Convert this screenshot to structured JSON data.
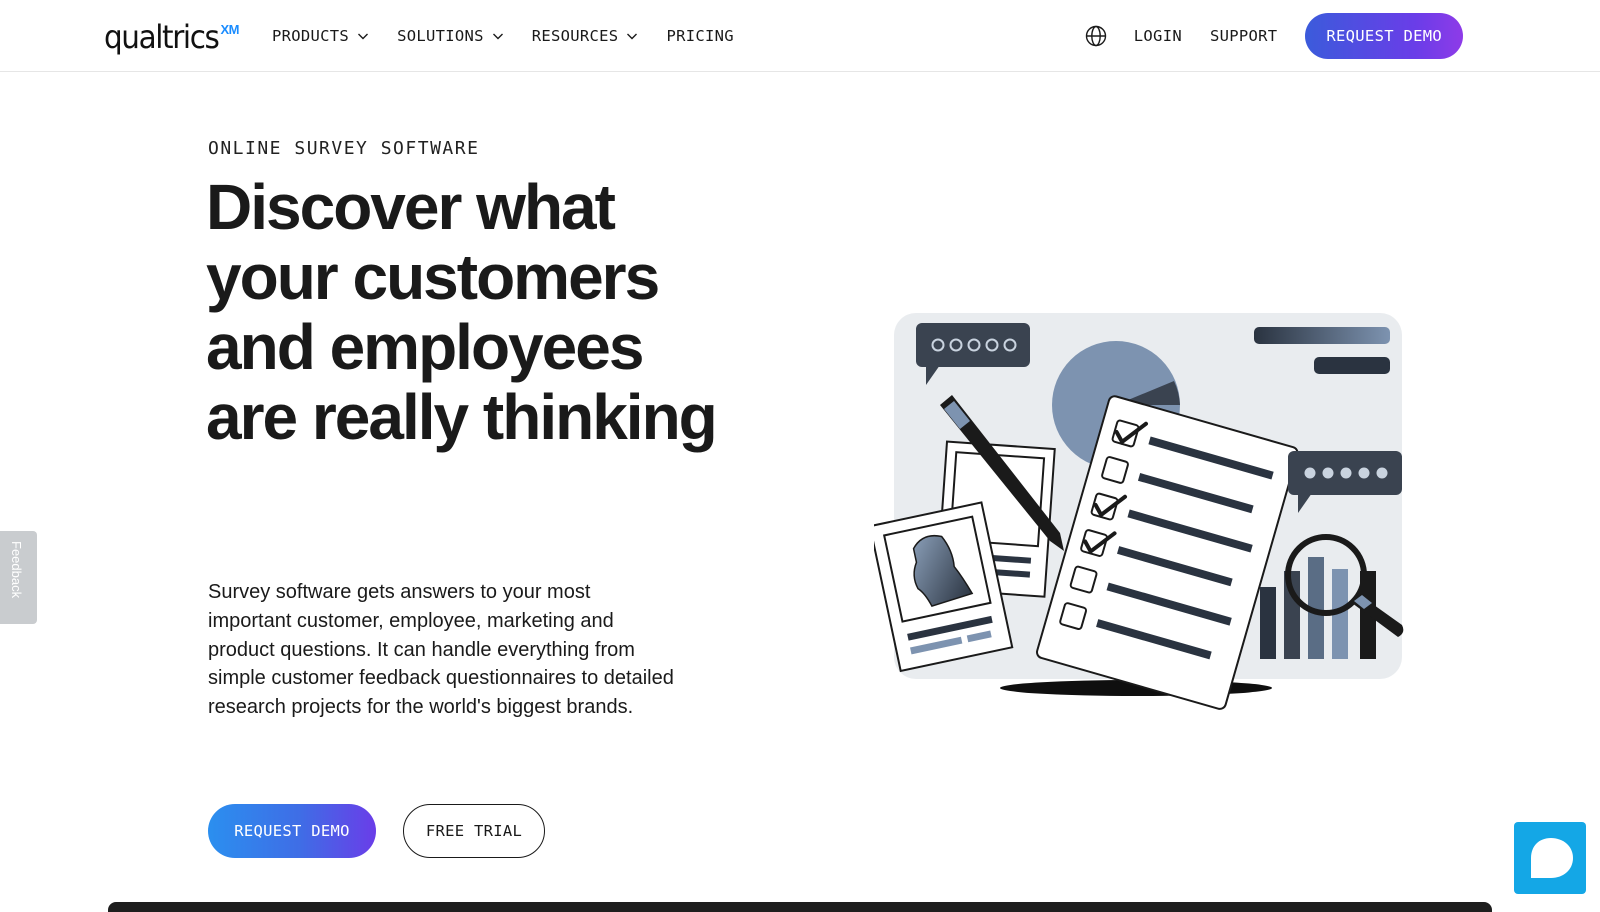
{
  "header": {
    "logo_word": "qualtrics",
    "logo_badge": "XM",
    "nav": [
      {
        "label": "PRODUCTS"
      },
      {
        "label": "SOLUTIONS"
      },
      {
        "label": "RESOURCES"
      },
      {
        "label": "PRICING"
      }
    ],
    "right_nav": {
      "login": "LOGIN",
      "support": "SUPPORT",
      "request_demo": "REQUEST DEMO"
    }
  },
  "hero": {
    "eyebrow": "ONLINE SURVEY SOFTWARE",
    "headline": "Discover what your customers and employees are really thinking",
    "body": "Survey software gets answers to your most important customer, employee, marketing and product questions. It can handle everything from simple customer feedback questionnaires to detailed research projects for the world's biggest brands.",
    "cta_primary": "REQUEST DEMO",
    "cta_secondary": "FREE TRIAL"
  },
  "feedback_tab": "Feedback",
  "icons": {
    "globe": "globe-icon",
    "chevron": "chevron-down-icon",
    "chat": "chat-bubble-icon"
  },
  "colors": {
    "brand_blue": "#1a8cff",
    "demo_gradient_start": "#3b5bdb",
    "demo_gradient_end": "#8e3be8",
    "chat_button": "#14a7e6",
    "illustration_bg": "#e9ecef",
    "illustration_dark": "#3a4350"
  }
}
